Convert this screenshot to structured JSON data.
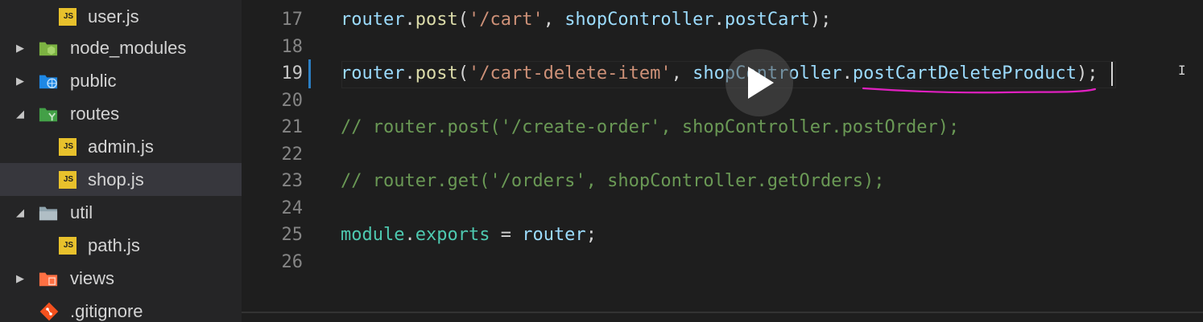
{
  "explorer": {
    "items": [
      {
        "label": "user.js",
        "icon": "javascript-file-icon",
        "twisty": ""
      },
      {
        "label": "node_modules",
        "icon": "node-folder-icon",
        "twisty": "▶"
      },
      {
        "label": "public",
        "icon": "globe-folder-icon",
        "twisty": "▶"
      },
      {
        "label": "routes",
        "icon": "routes-folder-icon",
        "twisty": "◢"
      },
      {
        "label": "admin.js",
        "icon": "javascript-file-icon",
        "twisty": ""
      },
      {
        "label": "shop.js",
        "icon": "javascript-file-icon",
        "twisty": ""
      },
      {
        "label": "util",
        "icon": "folder-icon",
        "twisty": "◢"
      },
      {
        "label": "path.js",
        "icon": "javascript-file-icon",
        "twisty": ""
      },
      {
        "label": "views",
        "icon": "views-folder-icon",
        "twisty": "▶"
      },
      {
        "label": ".gitignore",
        "icon": "git-icon",
        "twisty": ""
      }
    ],
    "selected": "shop.js",
    "js_badge": "JS"
  },
  "editor": {
    "active_line": "19",
    "lines": [
      {
        "n": "17",
        "tokens": [
          "router",
          ".",
          "post",
          "(",
          "'/cart'",
          ", ",
          "shopController",
          ".",
          "postCart",
          ");"
        ]
      },
      {
        "n": "18",
        "tokens": []
      },
      {
        "n": "19",
        "tokens": [
          "router",
          ".",
          "post",
          "(",
          "'/cart-delete-item'",
          ", ",
          "shopController",
          ".",
          "postCartDeleteProduct",
          ");"
        ]
      },
      {
        "n": "20",
        "tokens": []
      },
      {
        "n": "21",
        "comment": "// router.post('/create-order', shopController.postOrder);"
      },
      {
        "n": "22",
        "tokens": []
      },
      {
        "n": "23",
        "comment": "// router.get('/orders', shopController.getOrders);"
      },
      {
        "n": "24",
        "tokens": []
      },
      {
        "n": "25",
        "tokens": [
          "module",
          ".",
          "exports",
          " = ",
          "router",
          ";"
        ]
      },
      {
        "n": "26",
        "tokens": []
      }
    ]
  },
  "colors": {
    "sidebar_bg": "#252526",
    "editor_bg": "#1e1e1e",
    "underline": "#e020c0",
    "js_icon": "#e8c12c"
  },
  "overlay": {
    "icon": "play-icon"
  }
}
